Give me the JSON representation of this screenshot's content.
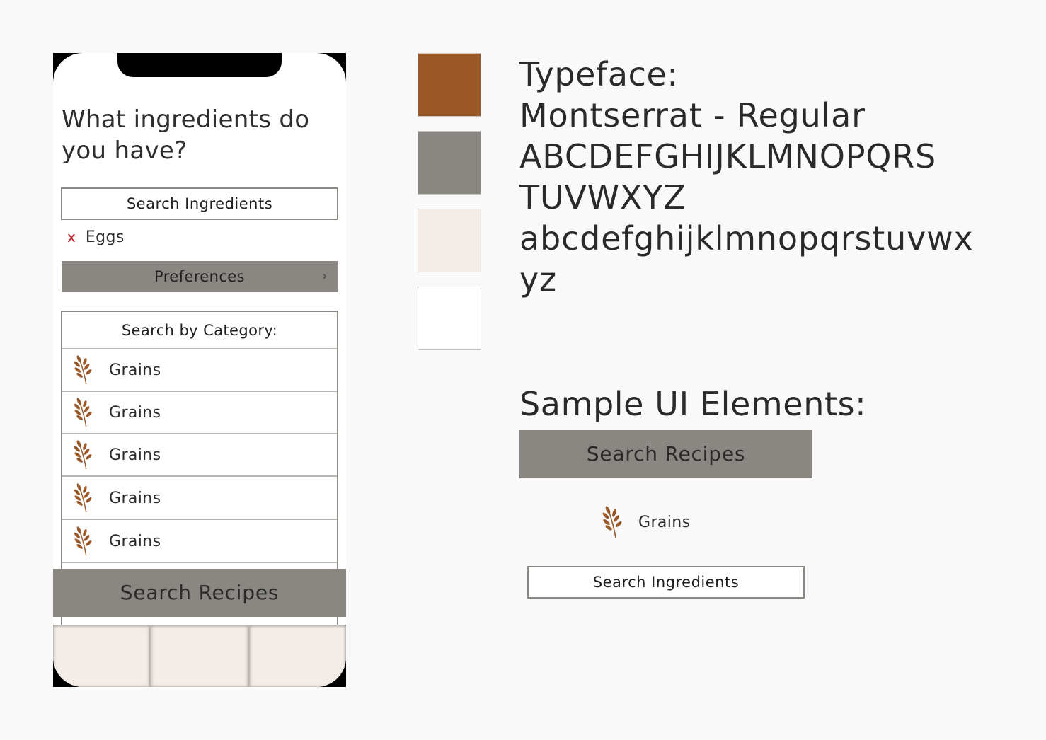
{
  "colors": {
    "brown": "#9a5828",
    "gray": "#8a8782",
    "cream": "#f3ece7",
    "white": "#ffffff",
    "remove_x": "#c8202a"
  },
  "phone": {
    "question": "What ingredients do you have?",
    "search_placeholder": "Search Ingredients",
    "selected_ingredients": [
      {
        "remove_icon": "x",
        "label": "Eggs"
      }
    ],
    "preferences_label": "Preferences",
    "preferences_chevron": "›",
    "category_heading": "Search by Category:",
    "categories": [
      {
        "icon": "wheat-icon",
        "label": "Grains"
      },
      {
        "icon": "wheat-icon",
        "label": "Grains"
      },
      {
        "icon": "wheat-icon",
        "label": "Grains"
      },
      {
        "icon": "wheat-icon",
        "label": "Grains"
      },
      {
        "icon": "wheat-icon",
        "label": "Grains"
      }
    ],
    "search_recipes_label": "Search Recipes",
    "tab_count": 3
  },
  "typeface": {
    "title": "Typeface:",
    "name": "Montserrat - Regular",
    "upper_line1": "ABCDEFGHIJKLMNOPQRS",
    "upper_line2": "TUVWXYZ",
    "lower_line1": "abcdefghijklmnopqrstuvwx",
    "lower_line2": "yz"
  },
  "sample": {
    "title": "Sample UI Elements:",
    "search_recipes_label": "Search Recipes",
    "category": {
      "icon": "wheat-icon",
      "label": "Grains"
    },
    "search_ingredients_label": "Search Ingredients"
  }
}
